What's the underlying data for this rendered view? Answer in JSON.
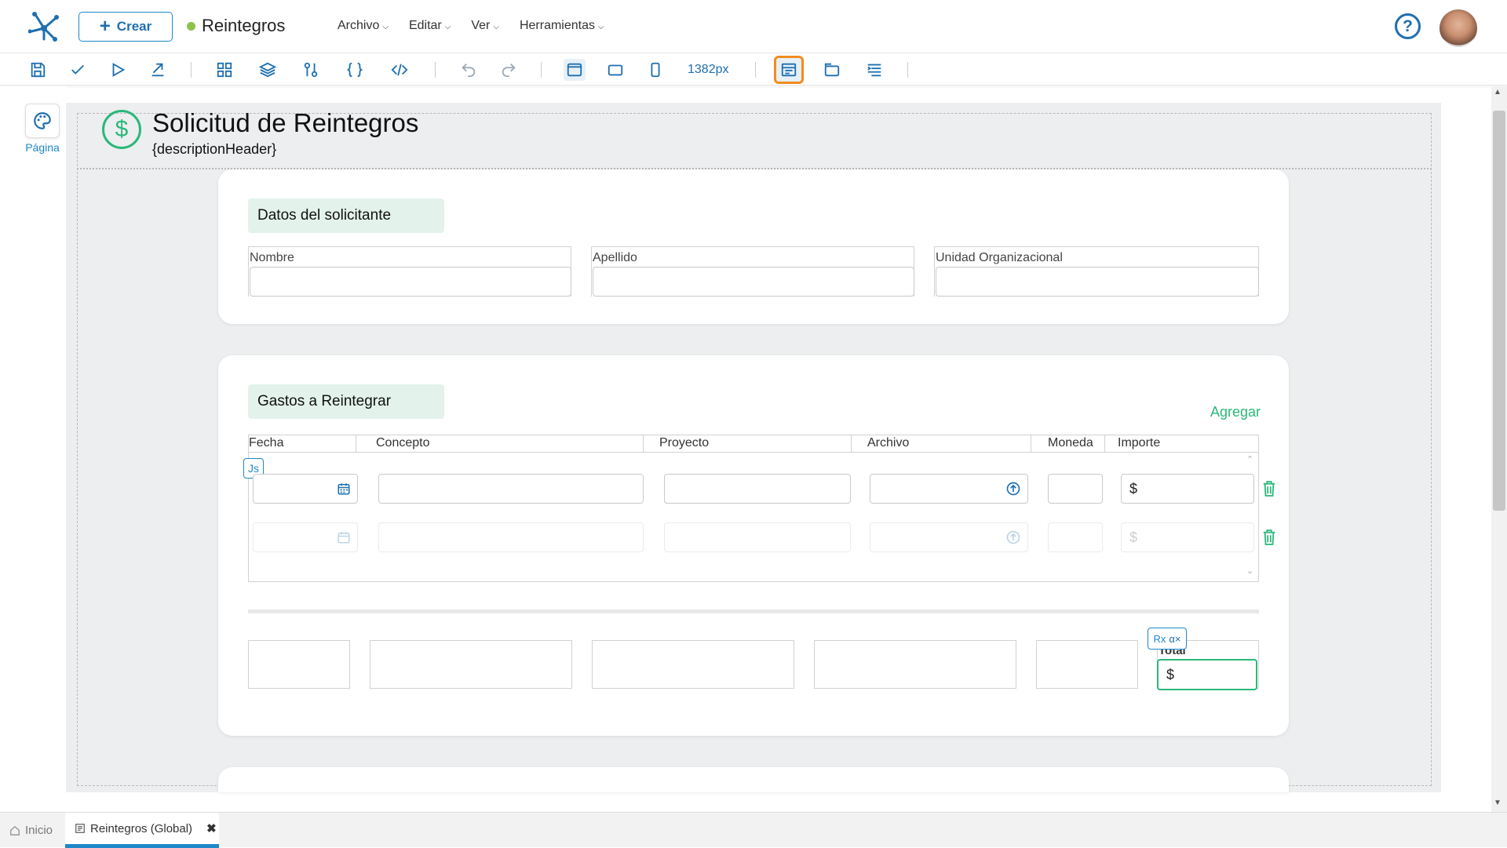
{
  "topbar": {
    "create_label": "Crear",
    "app_name": "Reintegros",
    "menus": [
      "Archivo",
      "Editar",
      "Ver",
      "Herramientas"
    ],
    "help_label": "?"
  },
  "toolbar": {
    "width_label": "1382px"
  },
  "sidebar": {
    "page_label": "Página"
  },
  "form": {
    "title": "Solicitud de Reintegros",
    "description": "{descriptionHeader}",
    "header_icon": "$",
    "section1": {
      "title": "Datos del solicitante",
      "fields": [
        "Nombre",
        "Apellido",
        "Unidad Organizacional"
      ]
    },
    "section2": {
      "title": "Gastos a Reintegrar",
      "add_label": "Agregar",
      "columns": [
        "Fecha",
        "Concepto",
        "Proyecto",
        "Archivo",
        "Moneda",
        "Importe"
      ],
      "js_badge": "Js",
      "currency_symbol": "$",
      "rx_badge": "Rx",
      "total_label": "Total",
      "total_symbol": "$"
    }
  },
  "bottom_tabs": {
    "home": "Inicio",
    "current": "Reintegros (Global)"
  },
  "colors": {
    "accent": "#1e88c8",
    "green": "#2bb87a",
    "highlight": "#f28c1e"
  }
}
